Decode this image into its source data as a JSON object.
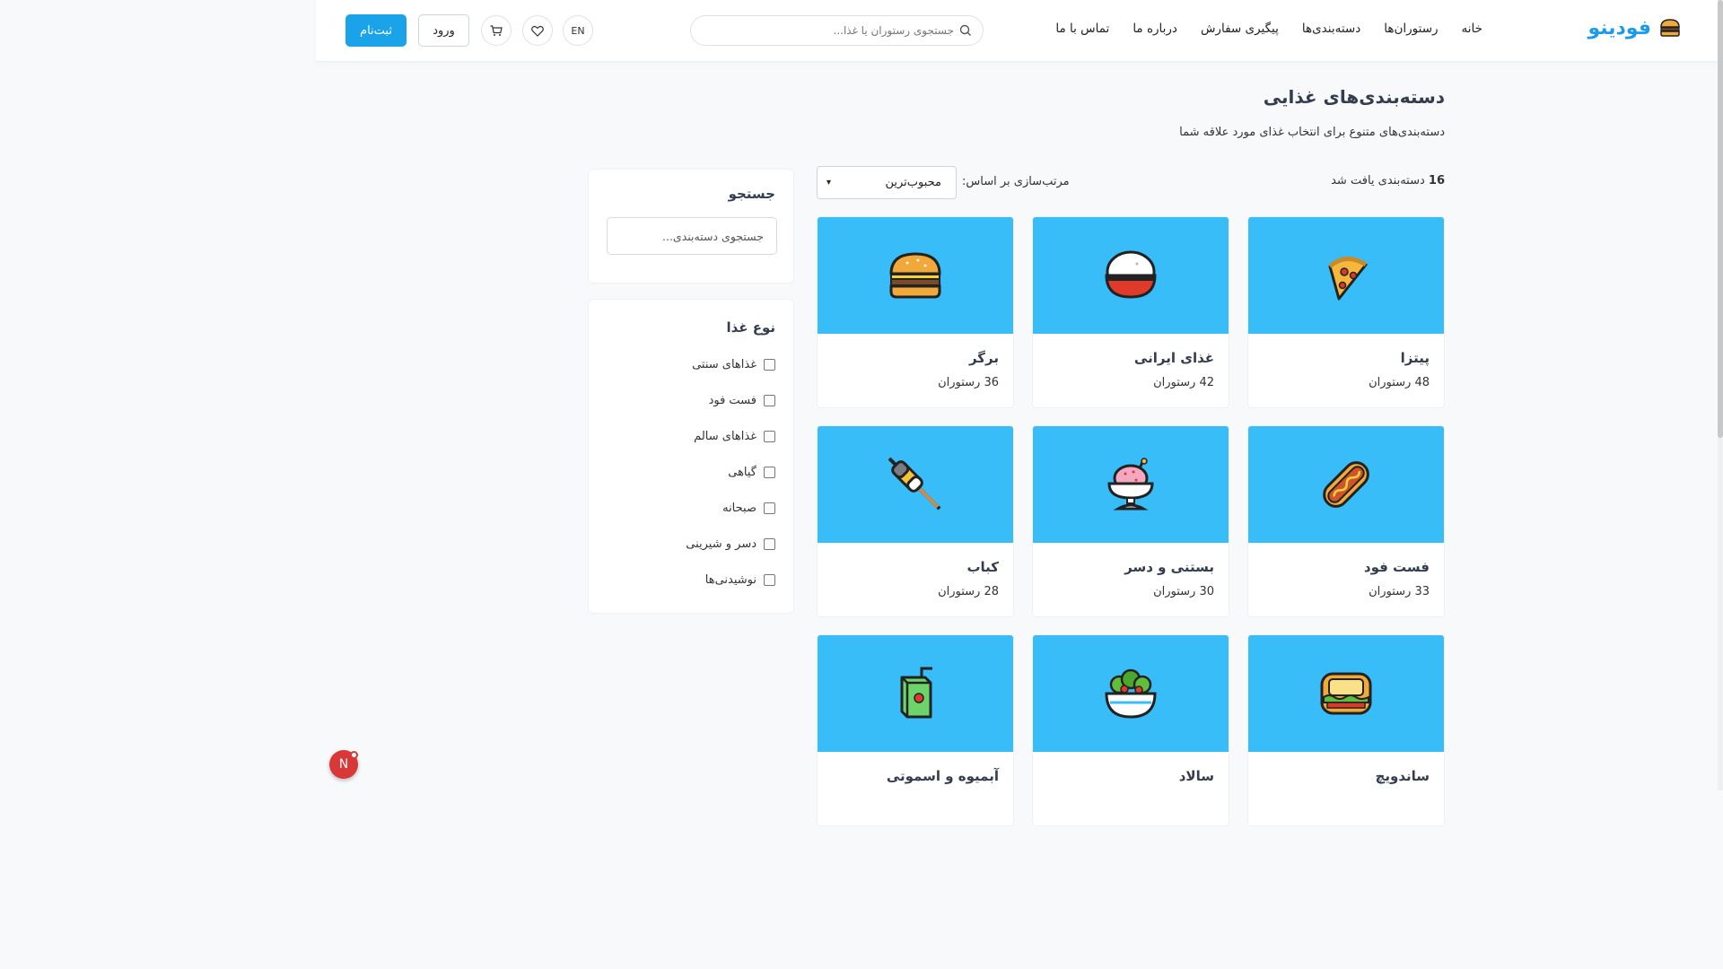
{
  "app": {
    "logo_text": "فودینو",
    "logo_icon": "burger-icon"
  },
  "nav": {
    "items": [
      "خانه",
      "رستوران‌ها",
      "دسته‌بندی‌ها",
      "پیگیری سفارش",
      "درباره ما",
      "تماس با ما"
    ]
  },
  "header": {
    "search_placeholder": "جستجوی رستوران یا غذا...",
    "lang": "EN",
    "login": "ورود",
    "signup": "ثبت‌نام"
  },
  "page": {
    "title": "دسته‌بندی‌های غذایی",
    "subtitle": "دسته‌بندی‌های متنوع برای انتخاب غذای مورد علاقه شما"
  },
  "results": {
    "count": "16",
    "found_text": "دسته‌بندی یافت شد",
    "sort_label": "مرتب‌سازی بر اساس:",
    "sort_value": "محبوب‌ترین"
  },
  "sidebar": {
    "search_title": "جستجو",
    "search_placeholder": "جستجوی دسته‌بندی...",
    "filter_title": "نوع غذا",
    "filters": [
      "غذاهای سنتی",
      "فست فود",
      "غذاهای سالم",
      "گیاهی",
      "صبحانه",
      "دسر و شیرینی",
      "نوشیدنی‌ها"
    ]
  },
  "categories": [
    {
      "name": "پیتزا",
      "count": "48 رستوران",
      "icon": "pizza-icon"
    },
    {
      "name": "غذای ایرانی",
      "count": "42 رستوران",
      "icon": "rice-bowl-icon"
    },
    {
      "name": "برگر",
      "count": "36 رستوران",
      "icon": "burger-icon"
    },
    {
      "name": "فست فود",
      "count": "33 رستوران",
      "icon": "hotdog-icon"
    },
    {
      "name": "بستنی و دسر",
      "count": "30 رستوران",
      "icon": "ice-cream-icon"
    },
    {
      "name": "کباب",
      "count": "28 رستوران",
      "icon": "kebab-icon"
    },
    {
      "name": "ساندویچ",
      "count": "",
      "icon": "sandwich-icon"
    },
    {
      "name": "سالاد",
      "count": "",
      "icon": "salad-icon"
    },
    {
      "name": "آبمیوه و اسموتی",
      "count": "",
      "icon": "juice-icon"
    }
  ],
  "floating": {
    "badge": "N"
  },
  "colors": {
    "accent": "#1aa3e8",
    "card_bg": "#38bdf8",
    "title": "#333d4d"
  }
}
